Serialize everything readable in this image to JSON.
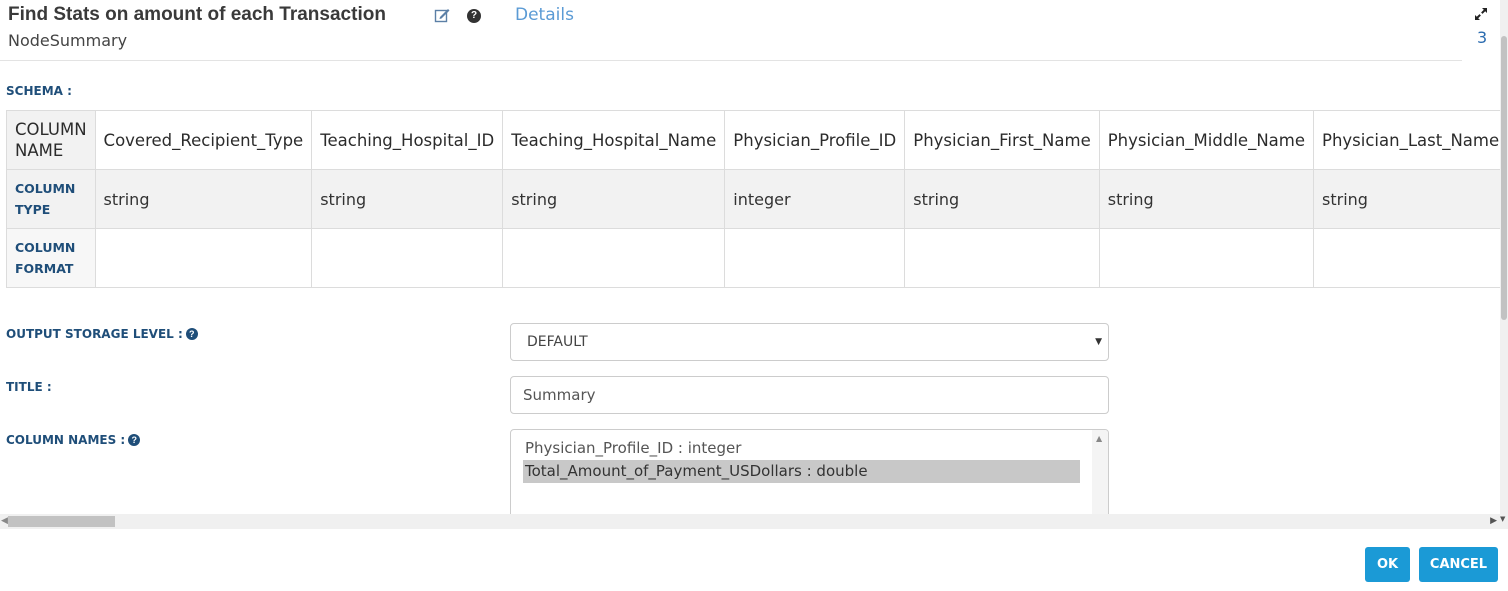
{
  "dialog": {
    "title": "Find Stats on amount of each Transaction",
    "details_link": "Details",
    "subtitle": "NodeSummary",
    "side_number": "3"
  },
  "schema": {
    "label": "SCHEMA :",
    "row_headers": [
      "COLUMN NAME",
      "COLUMN TYPE",
      "COLUMN FORMAT"
    ],
    "columns": [
      {
        "name": "Covered_Recipient_Type",
        "type": "string",
        "format": ""
      },
      {
        "name": "Teaching_Hospital_ID",
        "type": "string",
        "format": ""
      },
      {
        "name": "Teaching_Hospital_Name",
        "type": "string",
        "format": ""
      },
      {
        "name": "Physician_Profile_ID",
        "type": "integer",
        "format": ""
      },
      {
        "name": "Physician_First_Name",
        "type": "string",
        "format": ""
      },
      {
        "name": "Physician_Middle_Name",
        "type": "string",
        "format": ""
      },
      {
        "name": "Physician_Last_Name",
        "type": "string",
        "format": ""
      }
    ]
  },
  "form": {
    "output_storage_level": {
      "label": "OUTPUT STORAGE LEVEL :",
      "value": "DEFAULT"
    },
    "title": {
      "label": "TITLE :",
      "value": "Summary"
    },
    "column_names": {
      "label": "COLUMN NAMES :",
      "options": [
        "Physician_Profile_ID : integer",
        "Total_Amount_of_Payment_USDollars : double"
      ],
      "selected": "Total_Amount_of_Payment_USDollars : double"
    }
  },
  "buttons": {
    "ok": "OK",
    "cancel": "CANCEL"
  },
  "colors": {
    "accent": "#1b9ad6",
    "label": "#1f4e79",
    "link": "#5b9bd5"
  },
  "icons": [
    "edit-icon",
    "help-icon",
    "expand-icon",
    "chevron-down-icon",
    "scroll-left-arrow",
    "scroll-right-arrow"
  ]
}
